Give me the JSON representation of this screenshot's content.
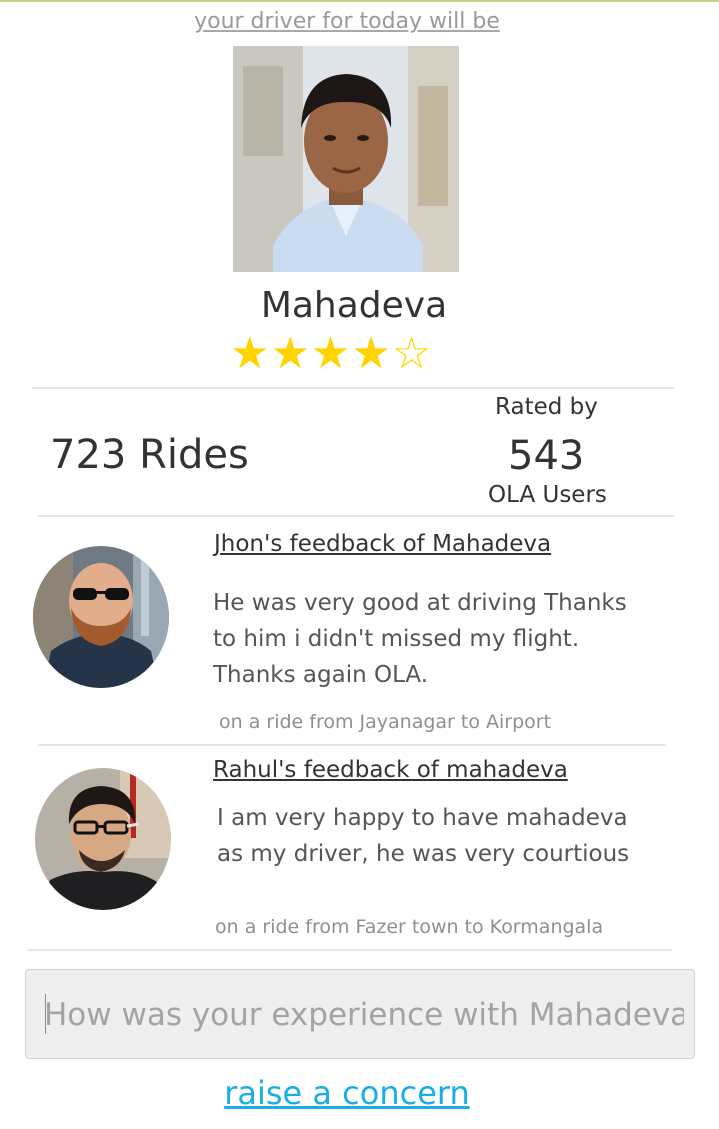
{
  "header": {
    "intro": "your driver for today will be"
  },
  "driver": {
    "name": "Mahadeva",
    "rating_stars": 4,
    "rating_max": 5,
    "rides": "723 Rides",
    "rated_by_label": "Rated by",
    "rated_by_count": "543",
    "rated_by_users": "OLA Users"
  },
  "feedback": [
    {
      "title": "Jhon's feedback of Mahadeva",
      "lines": [
        "He was very good at driving Thanks",
        "to him i didn't missed my flight.",
        "Thanks again OLA."
      ],
      "ride": "on a ride from Jayanagar to Airport"
    },
    {
      "title": "Rahul's feedback of mahadeva",
      "lines": [
        "I am very happy to have mahadeva",
        "as my driver, he was very courtious"
      ],
      "ride": "on a ride from Fazer town to Kormangala"
    }
  ],
  "experience": {
    "placeholder": "How was your experience with Mahadeva"
  },
  "concern": {
    "label": "raise a concern"
  },
  "colors": {
    "star": "#ffd400",
    "link": "#1aaee6"
  }
}
